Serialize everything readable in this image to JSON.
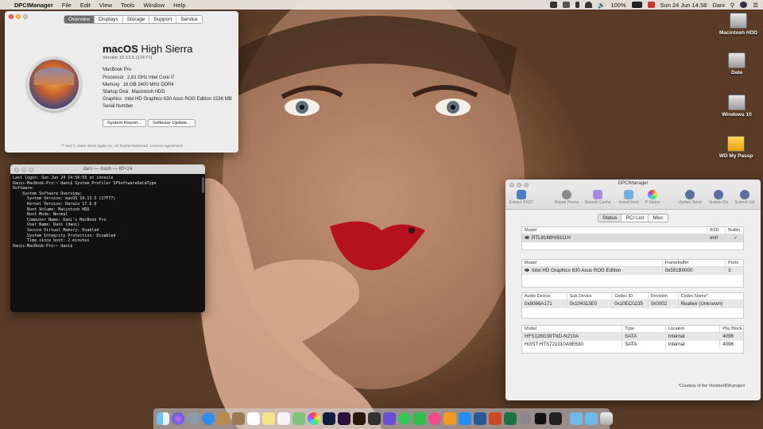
{
  "menubar": {
    "app_name": "DPCIManager",
    "items": [
      "File",
      "Edit",
      "View",
      "Tools",
      "Window",
      "Help"
    ],
    "battery": "100%",
    "clock": "Sun 24 Jun  14.58",
    "user": "Dani"
  },
  "about": {
    "tabs": [
      "Overview",
      "Displays",
      "Storage",
      "Support",
      "Service"
    ],
    "active_tab": "Overview",
    "os_name_bold": "macOS",
    "os_name_rest": "High Sierra",
    "version": "Version 10.13.5 (17F77)",
    "model": "MacBook Pro",
    "specs": [
      {
        "key": "Processor",
        "value": "2,81 GHz Intel Core i7"
      },
      {
        "key": "Memory",
        "value": "16 GB 2400 MHz DDR4"
      },
      {
        "key": "Startup Disk",
        "value": "Macintosh HDD"
      },
      {
        "key": "Graphics",
        "value": "Intel HD Graphics 630 Asus ROG Edition 1536 MB"
      },
      {
        "key": "Serial Number",
        "value": ""
      }
    ],
    "system_report_button": "System Report...",
    "software_update_button": "Software Update...",
    "footer": "™ and © 1983–2018 Apple Inc. All Rights Reserved. License Agreement"
  },
  "terminal": {
    "title": "dani — -bash — 80×24",
    "lines": [
      "Last login: Sun Jun 24 14:56:55 on console",
      "Danis-MacBook-Pro:~ dani$ System_Profiler SPSoftwareDataType",
      "Software:",
      "",
      "    System Software Overview:",
      "",
      "      System Version: macOS 10.13.5 (17F77)",
      "      Kernel Version: Darwin 17.6.0",
      "      Boot Volume: Macintosh HDD",
      "      Boot Mode: Normal",
      "      Computer Name: Dani's MacBook Pro",
      "      User Name: Dani (dani)",
      "      Secure Virtual Memory: Enabled",
      "      System Integrity Protection: Disabled",
      "      Time since boot: 2 minutes",
      "",
      "Danis-MacBook-Pro:~ dani$ "
    ]
  },
  "dpci": {
    "title": "DPCIManager",
    "toolbar": [
      "Extract DSDT",
      "Repair Perms",
      "Rebuild Cache",
      "Install Kext",
      "P States",
      "Update Seed",
      "Update IDs",
      "Submit List"
    ],
    "tabs": [
      "Status",
      "PCI List",
      "Misc"
    ],
    "active_tab": "Status",
    "network": {
      "headers": [
        "Model",
        "BSD",
        "Builtin"
      ],
      "rows": [
        [
          "RTL8168H/8111H",
          "en0",
          "✓"
        ]
      ]
    },
    "graphics": {
      "headers": [
        "Model",
        "Framebuffer",
        "Ports"
      ],
      "rows": [
        [
          "Intel HD Graphics 630 Asus ROG Edition",
          "0x591B0000",
          "3"
        ]
      ]
    },
    "audio": {
      "headers": [
        "Audio Device",
        "Sub Device",
        "Codec ID",
        "Revision",
        "Codec Name*"
      ],
      "rows": [
        [
          "0x8086A171",
          "0x104315E0",
          "0x10EC0235",
          "0x0002",
          "Realtek (Unknown)"
        ]
      ]
    },
    "storage": {
      "headers": [
        "Model",
        "Type",
        "Location",
        "Phy Block"
      ],
      "rows": [
        [
          "HFS128G39TND-N210A",
          "SATA",
          "Internal",
          "4096"
        ],
        [
          "HGST HTS721010A9E630",
          "SATA",
          "Internal",
          "4096"
        ]
      ]
    },
    "credit": "*Courtesy of the VoodooHDA project"
  },
  "desktop_icons": [
    "Macintosh HDD",
    "Data",
    "Windows 10",
    "WD My Passp"
  ],
  "dock_icons": [
    "finder-icon",
    "siri-icon",
    "launchpad-icon",
    "safari-icon",
    "notes-icon",
    "contacts-icon",
    "calendar-icon",
    "stickies-icon",
    "reminders-icon",
    "maps-icon",
    "photos-icon",
    "photoshop-icon",
    "premiere-icon",
    "illustrator-icon",
    "final-cut-icon",
    "imovie-icon",
    "messages-icon",
    "facetime-icon",
    "itunes-icon",
    "ibooks-icon",
    "app-store-icon",
    "word-icon",
    "powerpoint-icon",
    "excel-icon",
    "system-preferences-icon",
    "terminal-icon",
    "activity-monitor-icon",
    "downloads-folder-icon",
    "documents-folder-icon",
    "trash-icon"
  ]
}
